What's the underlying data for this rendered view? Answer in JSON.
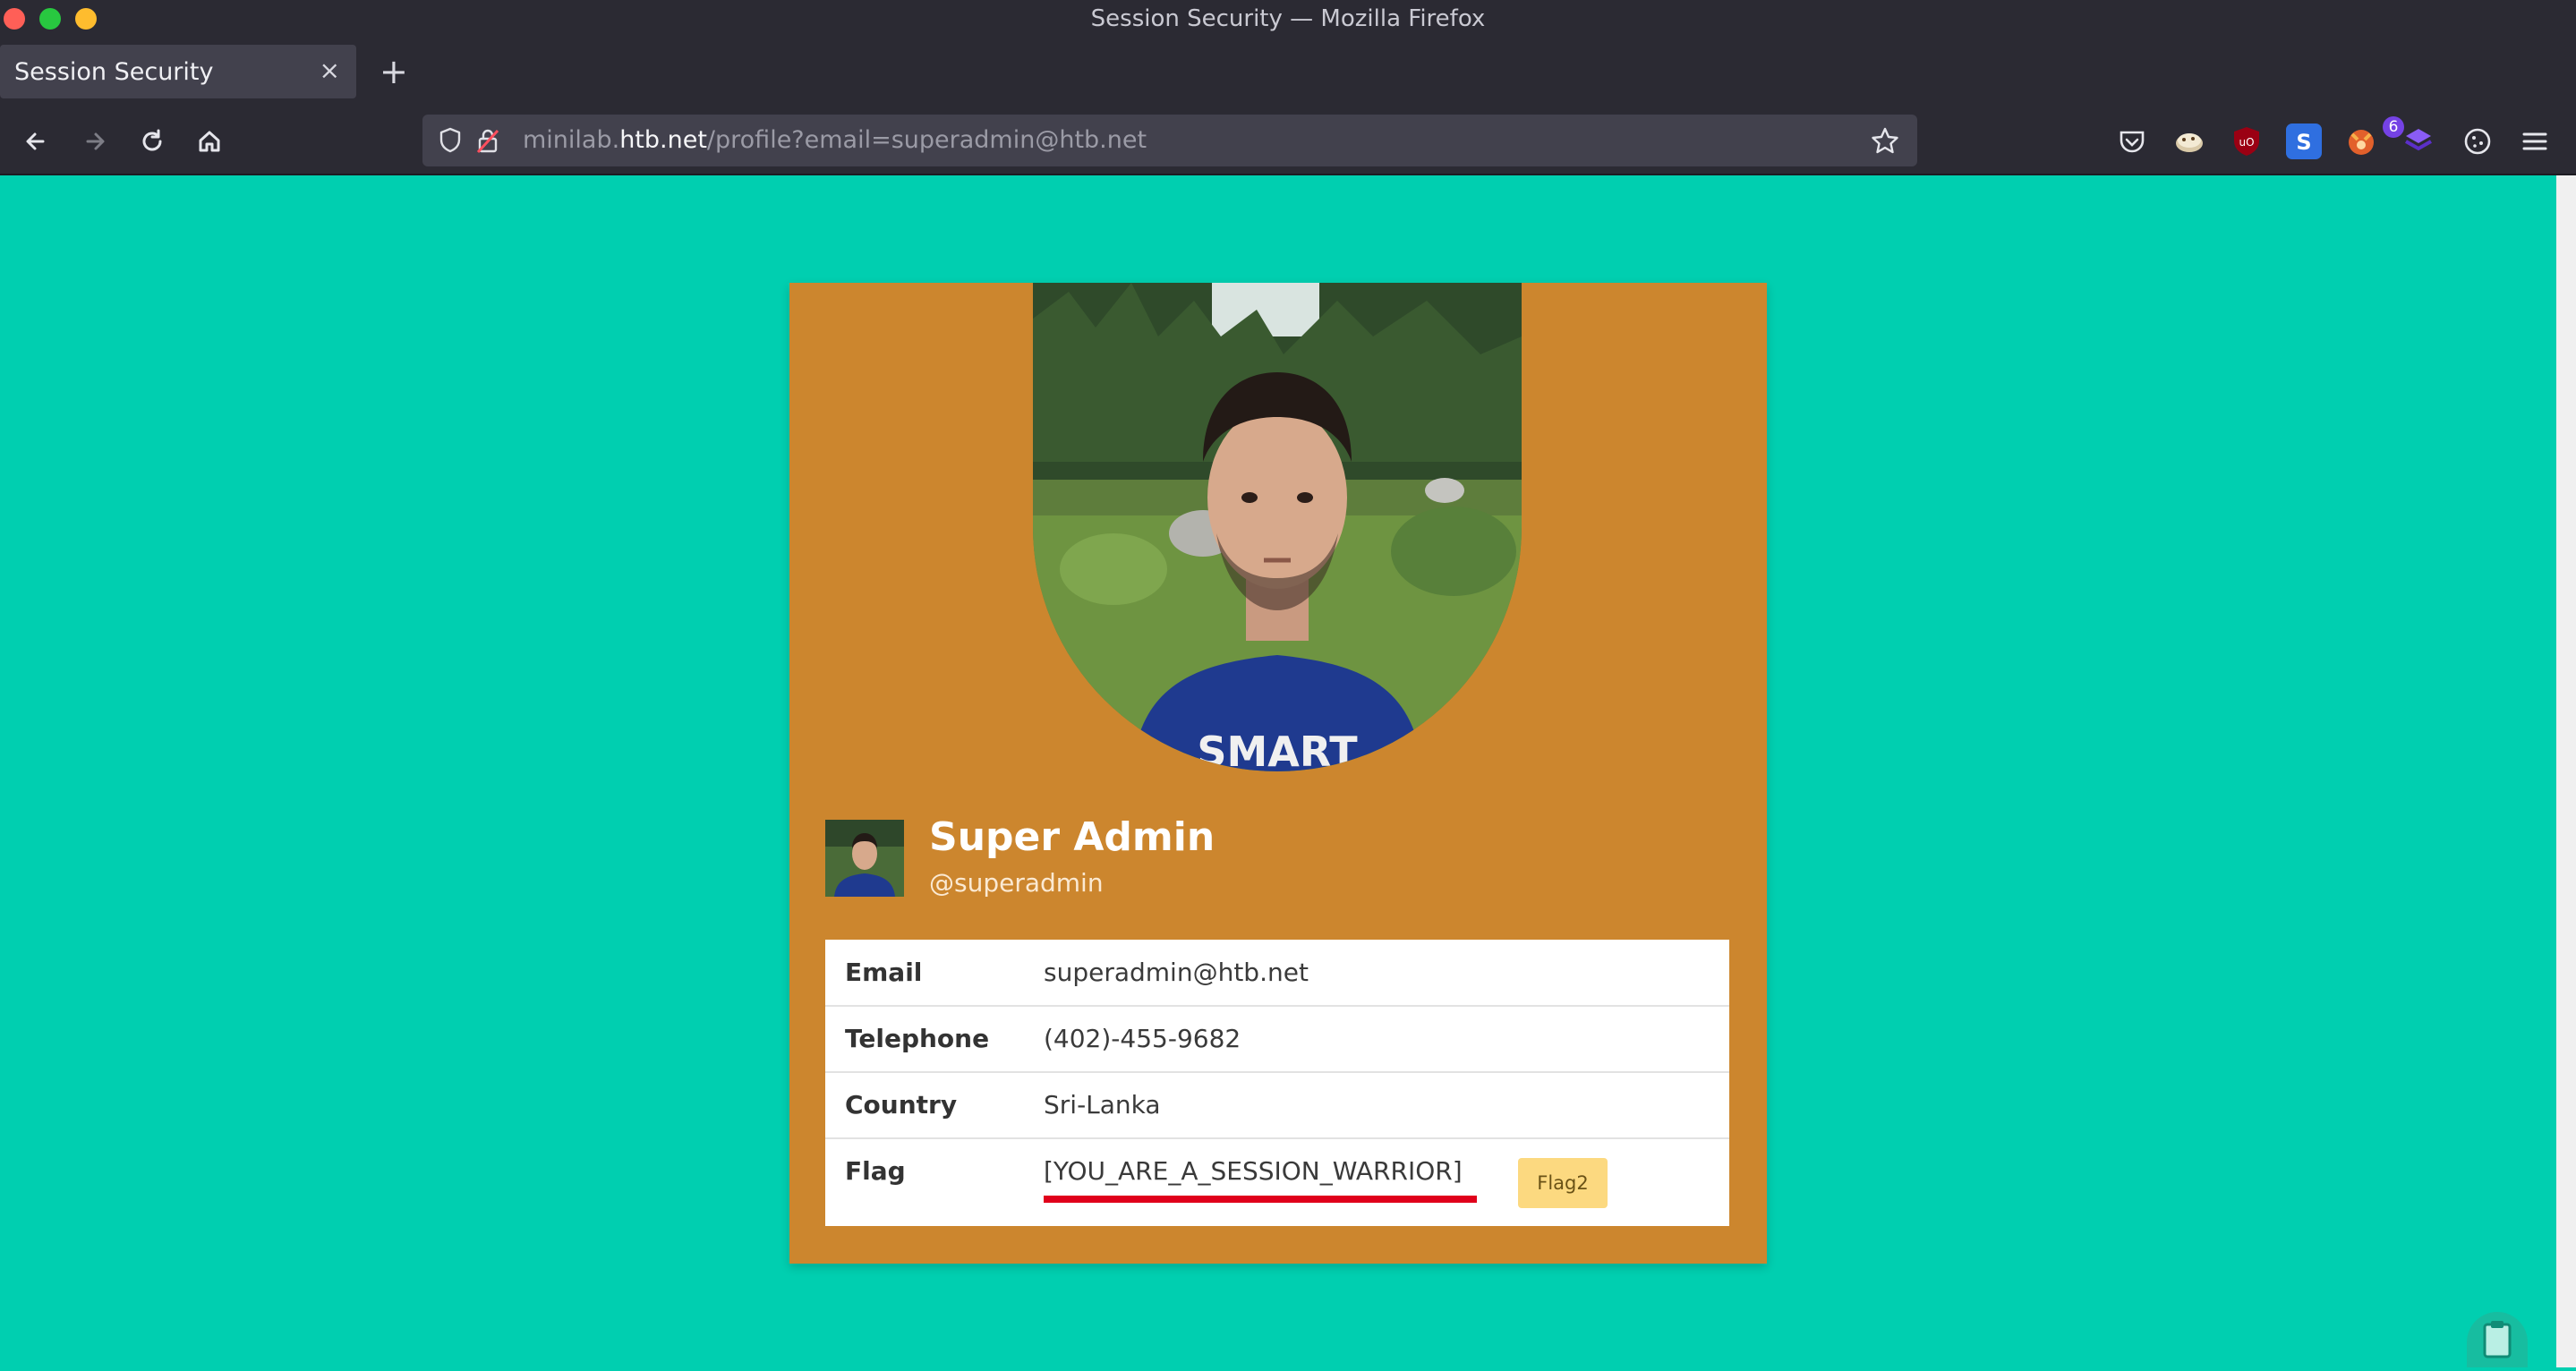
{
  "window": {
    "title": "Session Security — Mozilla Firefox"
  },
  "tabs": [
    {
      "label": "Session Security",
      "close": "×"
    }
  ],
  "newtab": "+",
  "nav": {
    "url_prefix": "minilab.",
    "url_host": "htb.net",
    "url_path": "/profile?email=superadmin@htb.net",
    "extension_badge": "6"
  },
  "profile": {
    "name": "Super Admin",
    "handle": "@superadmin",
    "rows": [
      {
        "label": "Email",
        "value": "superadmin@htb.net"
      },
      {
        "label": "Telephone",
        "value": "(402)-455-9682"
      },
      {
        "label": "Country",
        "value": "Sri-Lanka"
      },
      {
        "label": "Flag",
        "value": "[YOU_ARE_A_SESSION_WARRIOR]"
      }
    ],
    "flag_button": "Flag2",
    "shirt_text": "SMART"
  },
  "colors": {
    "page_bg": "#00cfb0",
    "card_bg": "#cc862e",
    "flag_underline": "#e0001b",
    "flag_button_bg": "#fcd980"
  }
}
